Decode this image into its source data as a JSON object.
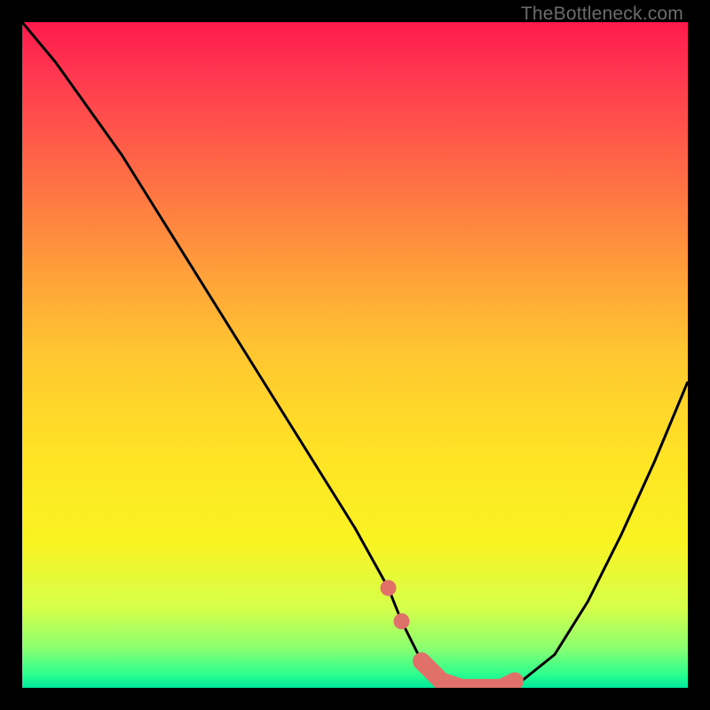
{
  "watermark": "TheBottleneck.com",
  "chart_data": {
    "type": "line",
    "title": "",
    "xlabel": "",
    "ylabel": "",
    "xlim": [
      0,
      100
    ],
    "ylim": [
      0,
      100
    ],
    "series": [
      {
        "name": "bottleneck-curve",
        "x": [
          0,
          5,
          10,
          15,
          20,
          25,
          30,
          35,
          40,
          45,
          50,
          55,
          57,
          60,
          63,
          66,
          69,
          72,
          75,
          80,
          85,
          90,
          95,
          100
        ],
        "values": [
          100,
          94,
          87,
          80,
          72,
          64,
          56,
          48,
          40,
          32,
          24,
          15,
          10,
          4,
          1,
          0,
          0,
          0,
          1,
          5,
          13,
          23,
          34,
          46
        ]
      }
    ],
    "highlight": {
      "name": "optimal-range",
      "color": "#e0706a",
      "x": [
        55,
        57,
        60,
        63,
        66,
        69,
        72,
        74
      ],
      "values": [
        15,
        10,
        4,
        1,
        0,
        0,
        0,
        1
      ]
    },
    "gradient_stops": [
      {
        "pos": 0.0,
        "color": "#ff1a4d"
      },
      {
        "pos": 0.5,
        "color": "#ffe325"
      },
      {
        "pos": 0.95,
        "color": "#8bff70"
      },
      {
        "pos": 1.0,
        "color": "#00e89b"
      }
    ]
  }
}
